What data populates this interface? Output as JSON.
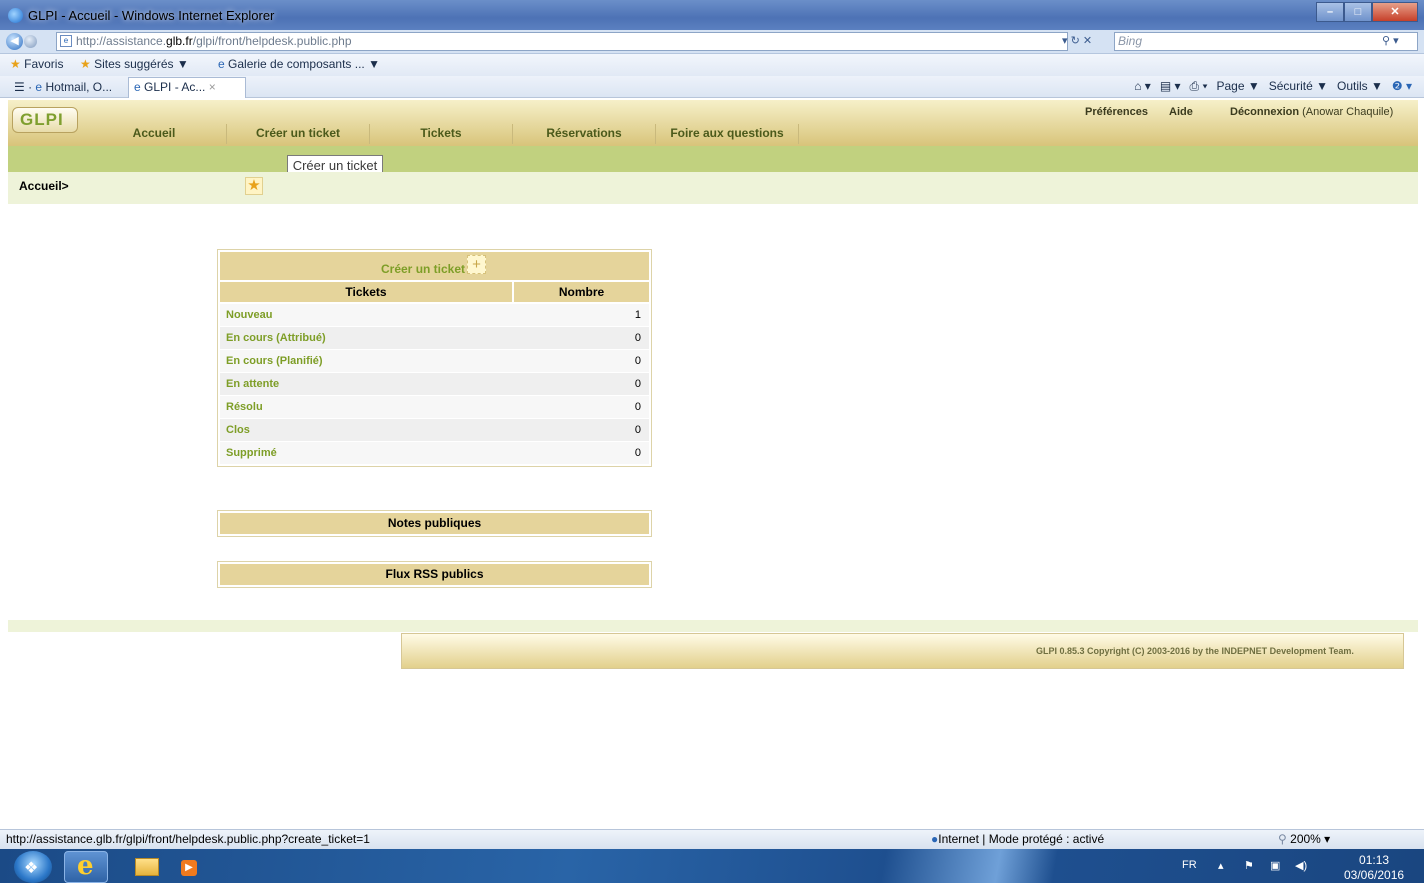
{
  "browser": {
    "window_title": "GLPI - Accueil - Windows Internet Explorer",
    "address_prefix": "http://assistance.",
    "address_domain": "glb.fr",
    "address_path": "/glpi/front/helpdesk.public.php",
    "search_placeholder": "Bing",
    "favorites": [
      "Favoris",
      "Sites suggérés ▼",
      "Galerie de composants ...  ▼"
    ],
    "tabs": [
      "Hotmail, O...",
      "GLPI - Ac..."
    ],
    "commands": [
      "Page ▼",
      "Sécurité ▼",
      "Outils ▼"
    ],
    "status_url": "http://assistance.glb.fr/glpi/front/helpdesk.public.php?create_ticket=1",
    "status_zone": "Internet | Mode protégé : activé",
    "status_zoom": "200%  ▾"
  },
  "glpi": {
    "logo": "GLPI",
    "top_links": [
      "Préférences",
      "Aide",
      "Déconnexion"
    ],
    "user": "(Anowar Chaquile)",
    "menu": [
      "Accueil",
      "Créer un ticket",
      "Tickets",
      "Réservations",
      "Foire aux questions"
    ],
    "tooltip": "Créer un ticket",
    "breadcrumb": "Accueil>",
    "ticket_table": {
      "create_link": "Créer un ticket",
      "headers": [
        "Tickets",
        "Nombre"
      ],
      "rows": [
        {
          "label": "Nouveau",
          "count": "1"
        },
        {
          "label": "En cours (Attribué)",
          "count": "0"
        },
        {
          "label": "En cours (Planifié)",
          "count": "0"
        },
        {
          "label": "En attente",
          "count": "0"
        },
        {
          "label": "Résolu",
          "count": "0"
        },
        {
          "label": "Clos",
          "count": "0"
        },
        {
          "label": "Supprimé",
          "count": "0"
        }
      ]
    },
    "notes_title": "Notes publiques",
    "rss_title": "Flux RSS publics",
    "footer": "GLPI 0.85.3 Copyright (C) 2003-2016 by the INDEPNET Development Team."
  },
  "taskbar": {
    "language": "FR",
    "time": "01:13",
    "date": "03/06/2016"
  },
  "colors": {
    "glpi_green": "#7e9e27",
    "glpi_beige": "#e5d49b",
    "menu_bar": "#c1d17f"
  }
}
